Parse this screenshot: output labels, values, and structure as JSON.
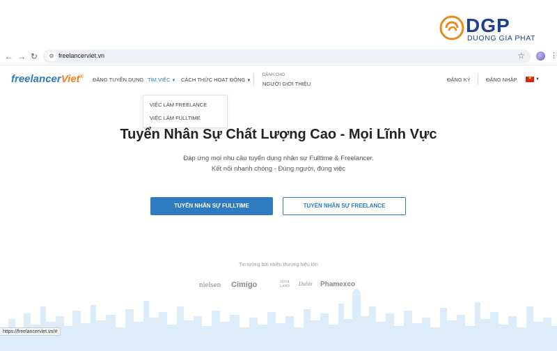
{
  "watermark": {
    "name": "DGP",
    "subtitle": "DUONG GIA PHAT"
  },
  "browser": {
    "url": "freelancerviet.vn",
    "status_url": "https://freelancerviet.vn/#"
  },
  "header": {
    "logo": {
      "part1": "freelancer",
      "part2": "Viet",
      "mark": "®"
    },
    "nav": {
      "post_job": "ĐĂNG TUYỂN DỤNG",
      "find_job": "TÌM VIỆC",
      "how_it_works": "CÁCH THỨC HOẠT ĐỘNG",
      "for_label": "DÀNH CHO",
      "referrer": "NGƯỜI GIỚI THIỆU",
      "register": "ĐĂNG KÝ",
      "login": "ĐĂNG NHẬP"
    }
  },
  "dropdown": {
    "items": [
      "VIỆC LÀM FREELANCE",
      "VIỆC LÀM FULLTIME"
    ]
  },
  "hero": {
    "title": "Tuyển Nhân Sự Chất Lượng Cao - Mọi Lĩnh Vực",
    "subtitle_line1": "Đáp ứng mọi nhu cầu tuyển dụng nhân sự Fulltime & Freelancer.",
    "subtitle_line2": "Kết nối nhanh chóng - Đúng người, đúng việc",
    "btn_fulltime": "TUYỂN NHÂN SỰ FULLTIME",
    "btn_freelance": "TUYỂN NHÂN SỰ FREELANCE"
  },
  "trust": {
    "label": "Tin tưởng bởi nhiều thương hiệu lớn",
    "brands": [
      "nielsen",
      "Cimigo",
      "NOVA LAND",
      "Dulux",
      "Phamexco"
    ]
  },
  "colors": {
    "primary": "#2e7bbf",
    "accent": "#f07f24",
    "dgp_blue": "#1f3f8f"
  }
}
